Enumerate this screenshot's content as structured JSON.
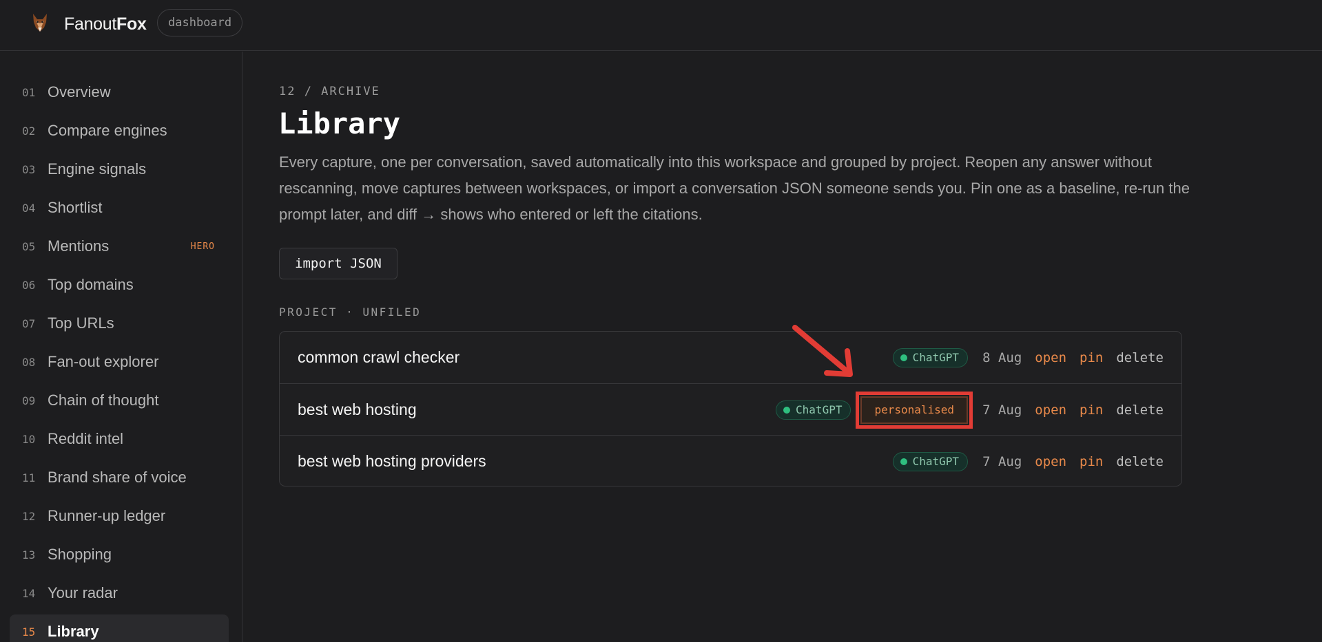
{
  "header": {
    "brand_prefix": "Fanout",
    "brand_bold": "Fox",
    "crumb": "dashboard"
  },
  "sidebar": {
    "items": [
      {
        "num": "01",
        "label": "Overview",
        "badge": ""
      },
      {
        "num": "02",
        "label": "Compare engines",
        "badge": ""
      },
      {
        "num": "03",
        "label": "Engine signals",
        "badge": ""
      },
      {
        "num": "04",
        "label": "Shortlist",
        "badge": ""
      },
      {
        "num": "05",
        "label": "Mentions",
        "badge": "HERO"
      },
      {
        "num": "06",
        "label": "Top domains",
        "badge": ""
      },
      {
        "num": "07",
        "label": "Top URLs",
        "badge": ""
      },
      {
        "num": "08",
        "label": "Fan-out explorer",
        "badge": ""
      },
      {
        "num": "09",
        "label": "Chain of thought",
        "badge": ""
      },
      {
        "num": "10",
        "label": "Reddit intel",
        "badge": ""
      },
      {
        "num": "11",
        "label": "Brand share of voice",
        "badge": ""
      },
      {
        "num": "12",
        "label": "Runner-up ledger",
        "badge": ""
      },
      {
        "num": "13",
        "label": "Shopping",
        "badge": ""
      },
      {
        "num": "14",
        "label": "Your radar",
        "badge": ""
      },
      {
        "num": "15",
        "label": "Library",
        "badge": "",
        "active": true
      }
    ]
  },
  "main": {
    "eyebrow": "12 / ARCHIVE",
    "title": "Library",
    "description": "Every capture, one per conversation, saved automatically into this workspace and grouped by project. Reopen any answer without rescanning, move captures between workspaces, or import a conversation JSON someone sends you. Pin one as a baseline, re-run the prompt later, and diff → shows who entered or left the citations.",
    "import_label": "import JSON",
    "section_label": "PROJECT · UNFILED",
    "captures": [
      {
        "title": "common crawl checker",
        "engine": "ChatGPT",
        "personalised": "",
        "date": "8 Aug",
        "open": "open",
        "pin": "pin",
        "delete": "delete"
      },
      {
        "title": "best web hosting",
        "engine": "ChatGPT",
        "personalised": "personalised",
        "date": "7 Aug",
        "open": "open",
        "pin": "pin",
        "delete": "delete"
      },
      {
        "title": "best web hosting providers",
        "engine": "ChatGPT",
        "personalised": "",
        "date": "7 Aug",
        "open": "open",
        "pin": "pin",
        "delete": "delete"
      }
    ]
  },
  "colors": {
    "accent": "#e8894a",
    "engine_green": "#2fbf7f",
    "annotation_red": "#e23c35",
    "background": "#1d1d1f"
  }
}
